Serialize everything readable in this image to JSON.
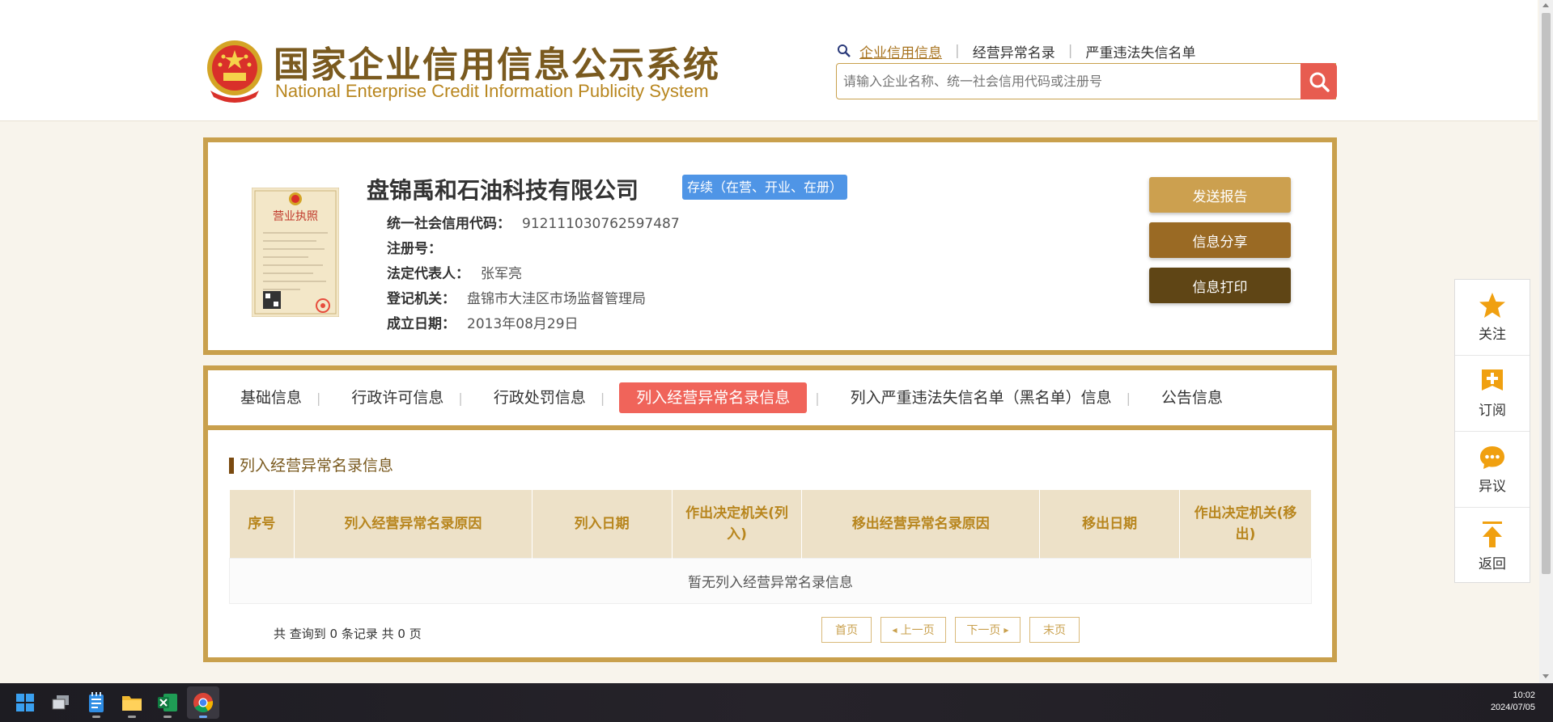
{
  "header": {
    "title_cn": "国家企业信用信息公示系统",
    "title_en": "National Enterprise Credit Information Publicity System",
    "nav": [
      "企业信用信息",
      "经营异常名录",
      "严重违法失信名单"
    ],
    "search_placeholder": "请输入企业名称、统一社会信用代码或注册号"
  },
  "company": {
    "name": "盘锦禹和石油科技有限公司",
    "status": "存续（在营、开业、在册）",
    "license_label": "营业执照",
    "fields": [
      {
        "label": "统一社会信用代码：",
        "value": "912111030762597487"
      },
      {
        "label": "注册号：",
        "value": ""
      },
      {
        "label": "法定代表人：",
        "value": "张军亮"
      },
      {
        "label": "登记机关：",
        "value": "盘锦市大洼区市场监督管理局"
      },
      {
        "label": "成立日期：",
        "value": "2013年08月29日"
      }
    ],
    "buttons": {
      "report": "发送报告",
      "share": "信息分享",
      "print": "信息打印"
    }
  },
  "tabs": [
    "基础信息",
    "行政许可信息",
    "行政处罚信息",
    "列入经营异常名录信息",
    "列入严重违法失信名单（黑名单）信息",
    "公告信息"
  ],
  "active_tab": "列入经营异常名录信息",
  "section": {
    "title": "列入经营异常名录信息",
    "columns": [
      "序号",
      "列入经营异常名录原因",
      "列入日期",
      "作出决定机关(列入)",
      "移出经营异常名录原因",
      "移出日期",
      "作出决定机关(移出)"
    ],
    "empty_text": "暂无列入经营异常名录信息"
  },
  "pagination": {
    "summary": "共 查询到 0 条记录 共 0 页",
    "first": "首页",
    "prev": "上一页",
    "next": "下一页",
    "last": "末页"
  },
  "side_panel": [
    "关注",
    "订阅",
    "异议",
    "返回"
  ],
  "taskbar": {
    "time": "10:02",
    "date": "2024/07/05"
  },
  "colors": {
    "gold": "#c9a04d",
    "active_tab": "#f0645a",
    "status_badge": "#4f95e6",
    "search_button": "#e75c50"
  }
}
